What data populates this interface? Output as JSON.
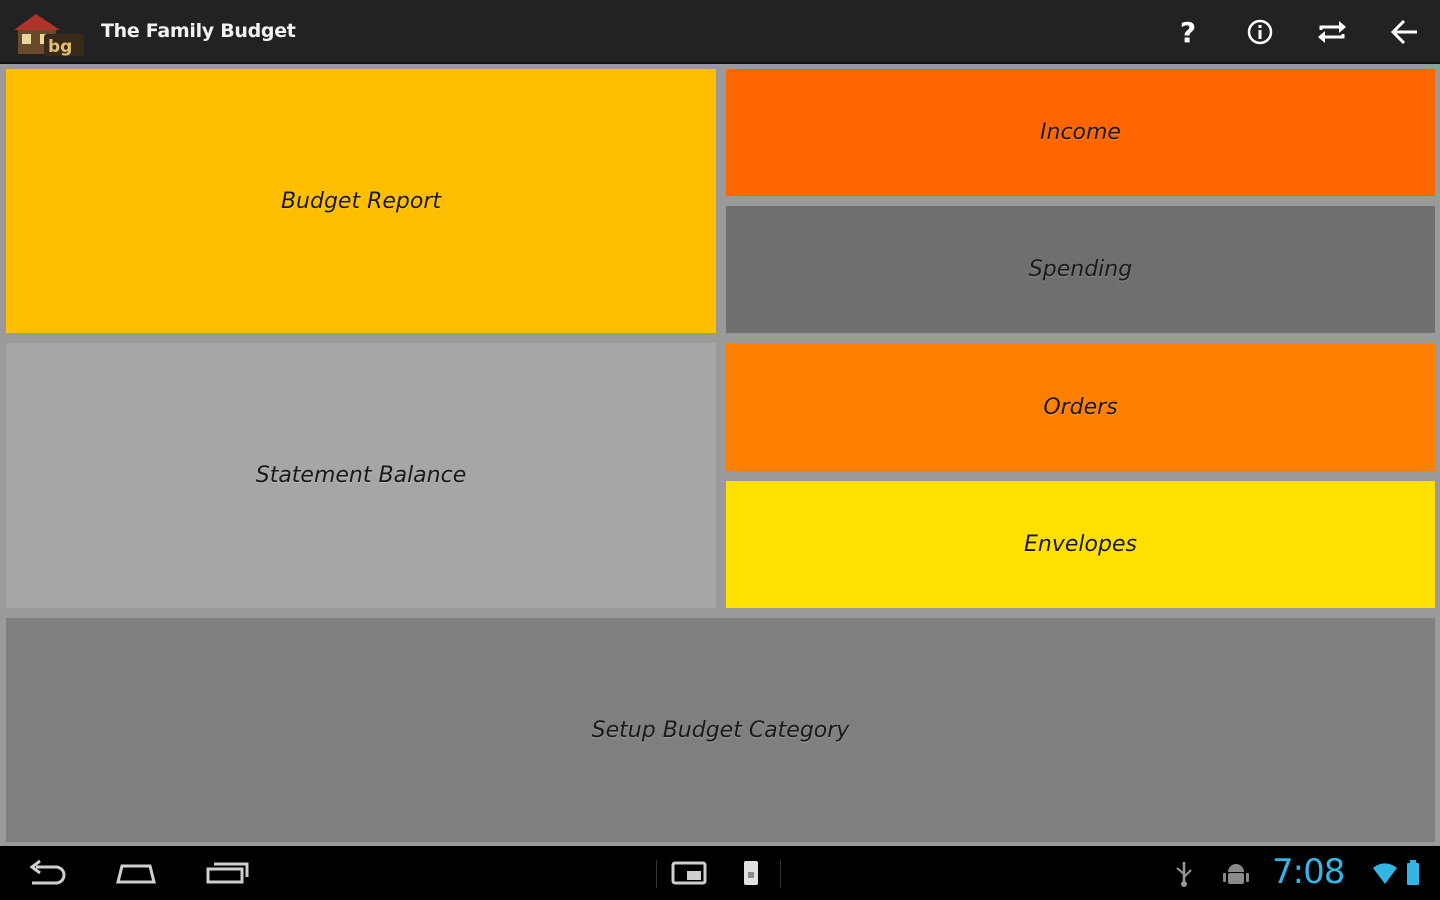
{
  "app": {
    "title": "The Family Budget",
    "logo_icon": "house-logo-icon"
  },
  "actionbar": {
    "actions": [
      {
        "icon": "help-icon"
      },
      {
        "icon": "info-icon"
      },
      {
        "icon": "sync-icon"
      },
      {
        "icon": "back-arrow-icon"
      }
    ]
  },
  "tiles": {
    "budget_report": {
      "label": "Budget Report",
      "color": "#ffbf00"
    },
    "income": {
      "label": "Income",
      "color": "#ff6600"
    },
    "spending": {
      "label": "Spending",
      "color": "#6f6f6f"
    },
    "statement_balance": {
      "label": "Statement Balance",
      "color": "#a6a6a6"
    },
    "orders": {
      "label": "Orders",
      "color": "#ff7f00"
    },
    "envelopes": {
      "label": "Envelopes",
      "color": "#ffe000"
    },
    "setup_budget_category": {
      "label": "Setup Budget Category",
      "color": "#7f7f7f"
    }
  },
  "system_bar": {
    "time": "7:08",
    "accent_color": "#33b5e5"
  }
}
